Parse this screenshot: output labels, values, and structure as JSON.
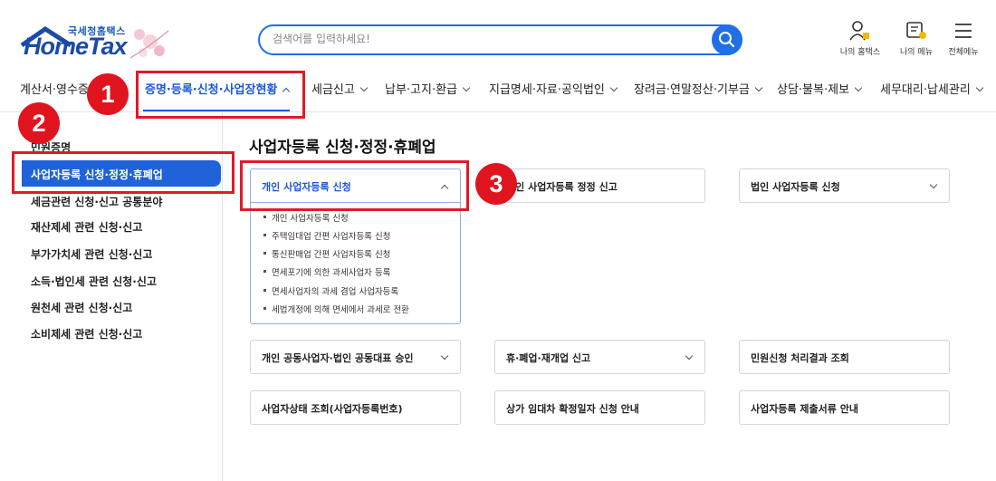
{
  "logo": {
    "sub": "국세청홈택스",
    "main": "HomeTax"
  },
  "search": {
    "placeholder": "검색어를 입력하세요!"
  },
  "util": [
    {
      "label": "나의 홈택스",
      "icon": "my-hometax-icon"
    },
    {
      "label": "나의 메뉴",
      "icon": "my-menu-icon"
    },
    {
      "label": "전체메뉴",
      "icon": "hamburger-icon"
    }
  ],
  "gnb": [
    {
      "label": "계산서·영수증"
    },
    {
      "label": "증명·등록·신청·사업장현황",
      "active": true
    },
    {
      "label": "세금신고"
    },
    {
      "label": "납부·고지·환급"
    },
    {
      "label": "지급명세·자료·공익법인"
    },
    {
      "label": "장려금·연말정산·기부금"
    },
    {
      "label": "상담·불복·제보"
    },
    {
      "label": "세무대리·납세관리"
    }
  ],
  "sidebar": [
    {
      "label": "민원증명"
    },
    {
      "label": "사업자등록 신청·정정·휴폐업",
      "active": true
    },
    {
      "label": "세금관련 신청·신고 공통분야"
    },
    {
      "label": "재산제세 관련 신청·신고"
    },
    {
      "label": "부가가치세 관련 신청·신고"
    },
    {
      "label": "소득·법인세 관련 신청·신고"
    },
    {
      "label": "원천세 관련 신청·신고"
    },
    {
      "label": "소비제세 관련 신청·신고"
    }
  ],
  "page_title": "사업자등록 신청·정정·휴폐업",
  "cards": [
    {
      "label": "개인 사업자등록 신청",
      "expanded": true
    },
    {
      "label": "개인 사업자등록 정정 신고"
    },
    {
      "label": "법인 사업자등록 신청"
    },
    {
      "label": "개인 공동사업자·법인 공동대표 승인"
    },
    {
      "label": "휴·폐업·재개업 신고"
    },
    {
      "label": "민원신청 처리결과 조회"
    },
    {
      "label": "사업자상태 조회(사업자등록번호)"
    },
    {
      "label": "상가 임대차 확정일자 신청 안내"
    },
    {
      "label": "사업자등록 제출서류 안내"
    }
  ],
  "submenu": [
    "개인 사업자등록 신청",
    "주택임대업 간편 사업자등록 신청",
    "통신판매업 간편 사업자등록 신청",
    "면세포기에 의한 과세사업자 등록",
    "면세사업자의 과세 겸업 사업자등록",
    "세법개정에 의해 면세에서 과세로 전환"
  ],
  "annotations": [
    "1",
    "2",
    "3"
  ],
  "colors": {
    "accent": "#1f62d9",
    "annotation": "#e0141f"
  }
}
